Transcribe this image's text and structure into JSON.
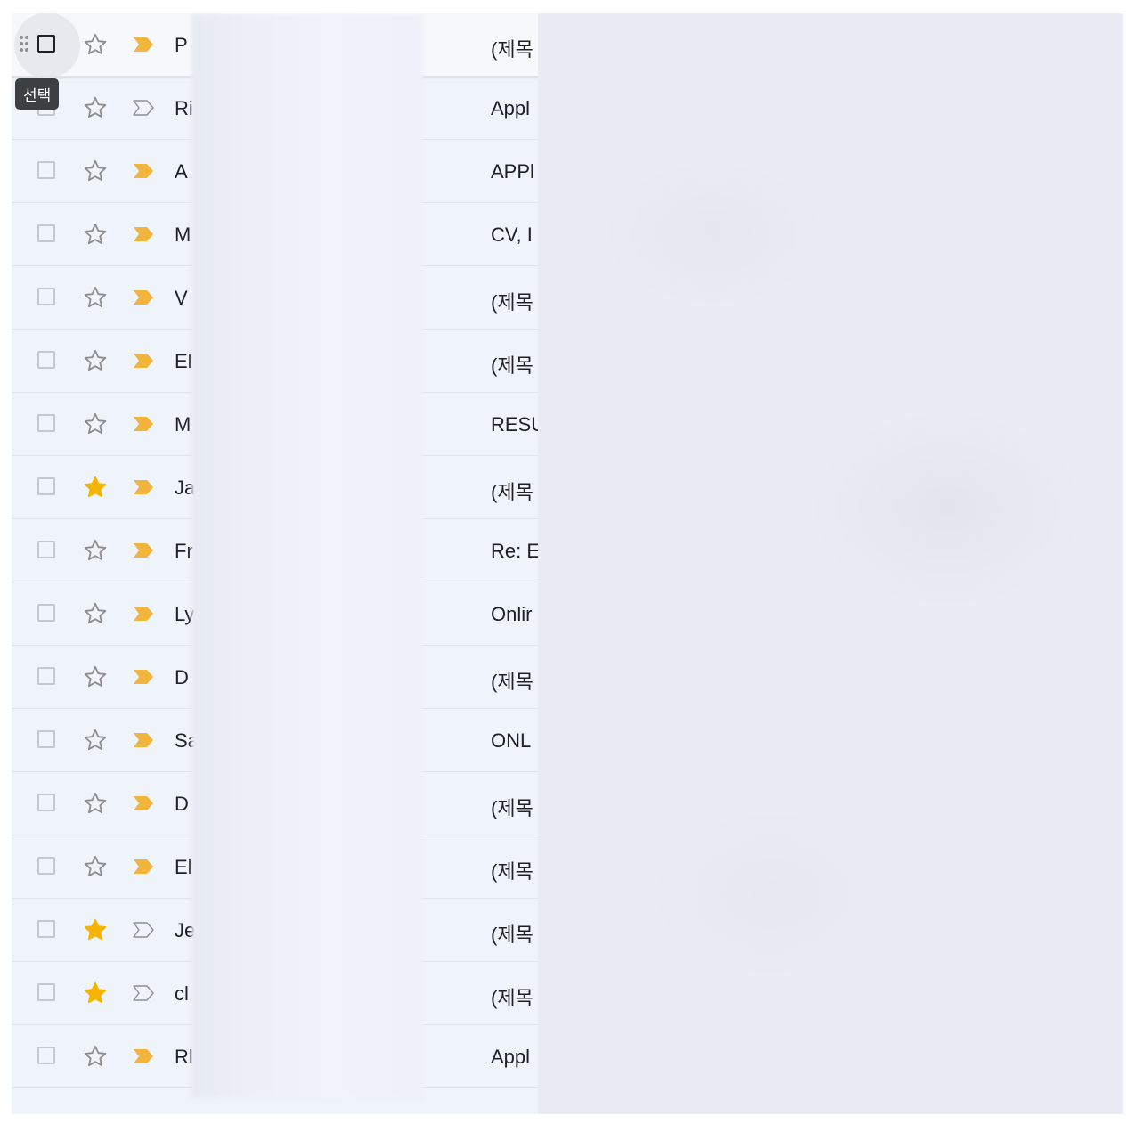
{
  "tooltip": "선택",
  "colors": {
    "list_bg": "#eff3fa",
    "important_on": "#f1b53d",
    "star_on": "#f4b400",
    "icon_off": "#8e8e8e"
  },
  "rows": [
    {
      "sender": "P",
      "subject": "(제목",
      "starred": false,
      "important": true,
      "hover": true
    },
    {
      "sender": "Ri",
      "subject": "Appl",
      "starred": false,
      "important": false
    },
    {
      "sender": "A",
      "subject": "APPl",
      "starred": false,
      "important": true
    },
    {
      "sender": "M",
      "subject": "CV, I",
      "starred": false,
      "important": true
    },
    {
      "sender": "V",
      "subject": "(제목",
      "starred": false,
      "important": true
    },
    {
      "sender": "El",
      "subject": "(제목",
      "starred": false,
      "important": true
    },
    {
      "sender": "M",
      "subject": "RESU",
      "starred": false,
      "important": true
    },
    {
      "sender": "Ja",
      "subject": "(제목",
      "starred": true,
      "important": true
    },
    {
      "sender": "Fr",
      "subject": "Re: E",
      "starred": false,
      "important": true
    },
    {
      "sender": "Ly",
      "subject": "Onlir",
      "starred": false,
      "important": true
    },
    {
      "sender": "D",
      "subject": "(제목",
      "starred": false,
      "important": true
    },
    {
      "sender": "Sa",
      "subject": "ONL",
      "starred": false,
      "important": true
    },
    {
      "sender": "D",
      "subject": "(제목",
      "starred": false,
      "important": true
    },
    {
      "sender": "El",
      "subject": "(제목",
      "starred": false,
      "important": true
    },
    {
      "sender": "Je",
      "subject": "(제목",
      "starred": true,
      "important": false
    },
    {
      "sender": "cl",
      "subject": "(제목",
      "starred": true,
      "important": false
    },
    {
      "sender": "Rl",
      "subject": "Appl",
      "starred": false,
      "important": true
    }
  ]
}
